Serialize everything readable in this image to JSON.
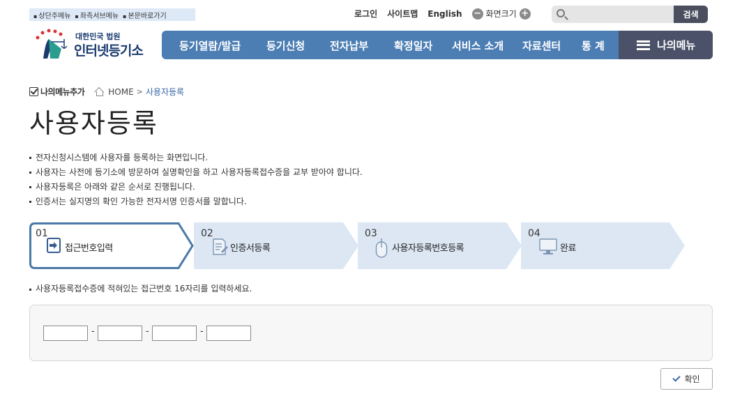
{
  "skip_links": [
    "상단주메뉴",
    "좌측서브메뉴",
    "본문바로가기"
  ],
  "util": {
    "login": "로그인",
    "sitemap": "사이트맵",
    "english": "English",
    "zoom_label": "화면크기",
    "zoom_out": "−",
    "zoom_in": "+"
  },
  "search": {
    "button": "검색",
    "placeholder": ""
  },
  "logo": {
    "line1": "대한민국 법원",
    "line2": "인터넷등기소"
  },
  "gnb": [
    "등기열람/발급",
    "등기신청",
    "전자납부",
    "확정일자",
    "서비스 소개",
    "자료센터",
    "통 계"
  ],
  "my_menu": "나의메뉴",
  "breadcrumb": {
    "add": "나의메뉴추가",
    "home": "HOME",
    "sep": ">",
    "current": "사용자등록"
  },
  "page_title": "사용자등록",
  "notes": [
    "전자신청시스템에 사용자를 등록하는 화면입니다.",
    "사용자는 사전에 등기소에 방문하여 실명확인을 하고 사용자등록접수증을 교부 받아야 합니다.",
    "사용자등록은 아래와 같은 순서로 진행됩니다.",
    "인증서는 실지명의 확인 가능한 전자서명 인증서를 말합니다."
  ],
  "steps": [
    {
      "num": "01",
      "label": "접근번호입력",
      "active": true
    },
    {
      "num": "02",
      "label": "인증서등록",
      "active": false
    },
    {
      "num": "03",
      "label": "사용자등록번호등록",
      "active": false
    },
    {
      "num": "04",
      "label": "완료",
      "active": false
    }
  ],
  "guide": "사용자등록접수증에 적혀있는 접근번호 16자리를 입력하세요.",
  "access_fields": [
    "",
    "",
    "",
    ""
  ],
  "dash": "-",
  "confirm_button": "확인",
  "colors": {
    "gnb": "#4c7eb4",
    "mymenu": "#4a5168",
    "step_active_border": "#4a78a8",
    "step_bg": "#dce7f3"
  }
}
